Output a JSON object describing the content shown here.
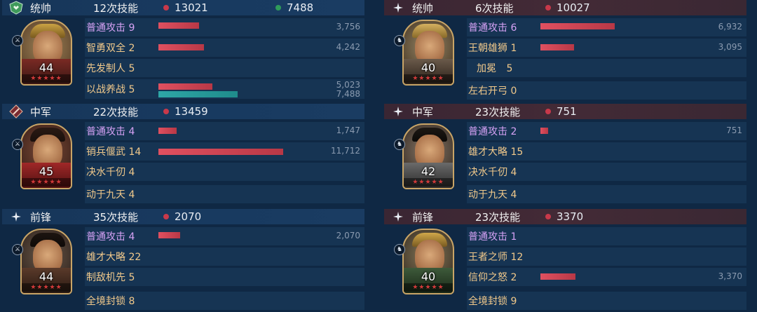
{
  "teams": [
    {
      "side": "left",
      "generals": [
        {
          "position": "统帅",
          "casts": "12次技能",
          "damage": "13021",
          "heal": "7488",
          "level": "44",
          "stars": "★★★★★",
          "skills": [
            {
              "name": "普通攻击",
              "count": "9",
              "type": "normal",
              "dmg_value": "3,756",
              "dmg_ratio": 0.24
            },
            {
              "name": "智勇双全",
              "count": "2",
              "type": "skill",
              "dmg_value": "4,242",
              "dmg_ratio": 0.27
            },
            {
              "name": "先发制人",
              "count": "5",
              "type": "skill"
            },
            {
              "name": "以战养战",
              "count": "5",
              "type": "skill",
              "dmg_value": "5,023",
              "dmg_ratio": 0.32,
              "heal_value": "7,488",
              "heal_ratio": 0.47
            }
          ]
        },
        {
          "position": "中军",
          "casts": "22次技能",
          "damage": "13459",
          "level": "45",
          "stars": "★★★★★",
          "skills": [
            {
              "name": "普通攻击",
              "count": "4",
              "type": "normal",
              "dmg_value": "1,747",
              "dmg_ratio": 0.11
            },
            {
              "name": "销兵偃武",
              "count": "14",
              "type": "skill",
              "dmg_value": "11,712",
              "dmg_ratio": 0.74
            },
            {
              "name": "决水千仞",
              "count": "4",
              "type": "skill"
            },
            {
              "name": "动于九天",
              "count": "4",
              "type": "skill"
            }
          ]
        },
        {
          "position": "前锋",
          "casts": "35次技能",
          "damage": "2070",
          "level": "44",
          "stars": "★★★★★",
          "skills": [
            {
              "name": "普通攻击",
              "count": "4",
              "type": "normal",
              "dmg_value": "2,070",
              "dmg_ratio": 0.13
            },
            {
              "name": "雄才大略",
              "count": "22",
              "type": "skill"
            },
            {
              "name": "制敌机先",
              "count": "5",
              "type": "skill"
            },
            {
              "name": "全境封锁",
              "count": "8",
              "type": "skill"
            }
          ]
        }
      ]
    },
    {
      "side": "right",
      "generals": [
        {
          "position": "统帅",
          "casts": "6次技能",
          "damage": "10027",
          "level": "40",
          "stars": "★★★★★",
          "skills": [
            {
              "name": "普通攻击",
              "count": "6",
              "type": "normal",
              "dmg_value": "6,932",
              "dmg_ratio": 0.44
            },
            {
              "name": "王朝雄狮",
              "count": "1",
              "type": "skill",
              "dmg_value": "3,095",
              "dmg_ratio": 0.2
            },
            {
              "name": "加冕",
              "count": "5",
              "type": "skill"
            },
            {
              "name": "左右开弓",
              "count": "0",
              "type": "skill"
            }
          ]
        },
        {
          "position": "中军",
          "casts": "23次技能",
          "damage": "751",
          "level": "42",
          "stars": "★★★★★",
          "skills": [
            {
              "name": "普通攻击",
              "count": "2",
              "type": "normal",
              "dmg_value": "751",
              "dmg_ratio": 0.045
            },
            {
              "name": "雄才大略",
              "count": "15",
              "type": "skill"
            },
            {
              "name": "决水千仞",
              "count": "4",
              "type": "skill"
            },
            {
              "name": "动于九天",
              "count": "4",
              "type": "skill"
            }
          ]
        },
        {
          "position": "前锋",
          "casts": "23次技能",
          "damage": "3370",
          "level": "40",
          "stars": "★★★★★",
          "skills": [
            {
              "name": "普通攻击",
              "count": "1",
              "type": "normal"
            },
            {
              "name": "王者之师",
              "count": "12",
              "type": "skill"
            },
            {
              "name": "信仰之怒",
              "count": "2",
              "type": "skill",
              "dmg_value": "3,370",
              "dmg_ratio": 0.21
            },
            {
              "name": "全境封锁",
              "count": "9",
              "type": "skill"
            }
          ]
        }
      ]
    }
  ]
}
